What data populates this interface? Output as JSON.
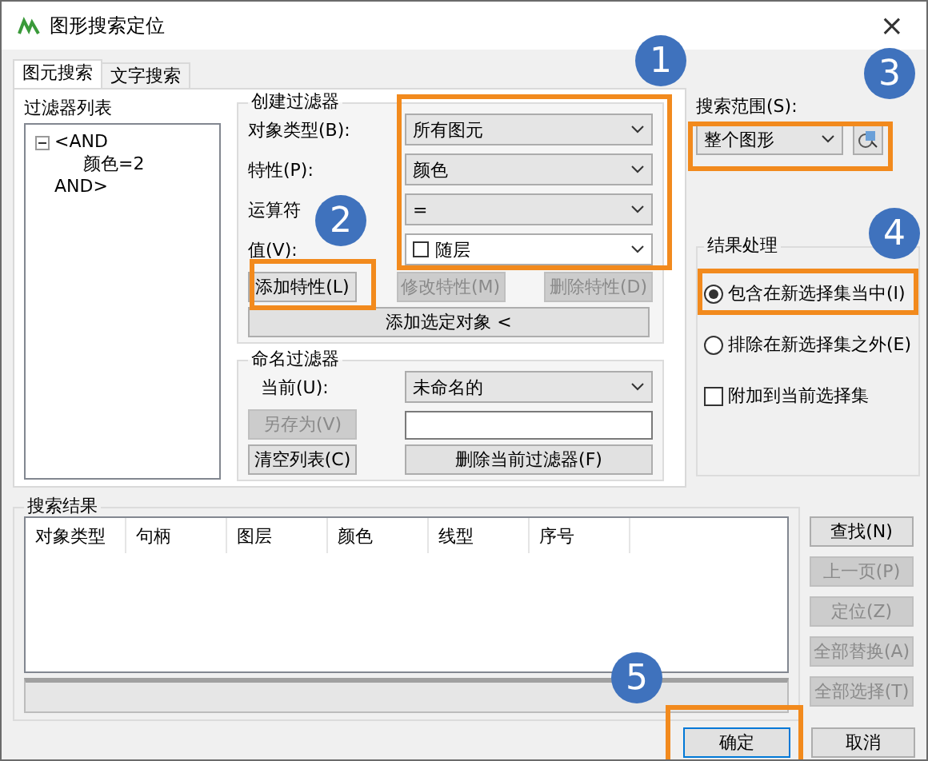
{
  "window": {
    "title": "图形搜索定位",
    "close": "×"
  },
  "tabs": [
    {
      "label": "图元搜索",
      "selected": true
    },
    {
      "label": "文字搜索",
      "selected": false
    }
  ],
  "filter_list": {
    "label": "过滤器列表",
    "tree": [
      {
        "label": "<AND",
        "expanded": true,
        "children": [
          {
            "label": "颜色=2"
          }
        ]
      },
      {
        "label": "AND>"
      }
    ]
  },
  "create_filter": {
    "title": "创建过滤器",
    "fields": [
      {
        "label": "对象类型(B):",
        "value": "所有图元",
        "kind": "select"
      },
      {
        "label": "特性(P):",
        "value": "颜色",
        "kind": "select"
      },
      {
        "label": "运算符",
        "value": "=",
        "kind": "select"
      },
      {
        "label": "值(V):",
        "value": "随层",
        "kind": "swatch"
      }
    ],
    "buttons": [
      {
        "label": "添加特性(L)",
        "disabled": false
      },
      {
        "label": "修改特性(M)",
        "disabled": true
      },
      {
        "label": "删除特性(D)",
        "disabled": true
      }
    ],
    "add_selected": "添加选定对象 <"
  },
  "named_filter": {
    "title": "命名过滤器",
    "current_label": "当前(U):",
    "current_value": "未命名的",
    "save_as": {
      "label": "另存为(V)",
      "disabled": true
    },
    "clear": "清空列表(C)",
    "delete": "删除当前过滤器(F)"
  },
  "search_scope": {
    "label": "搜索范围(S):",
    "value": "整个图形"
  },
  "result_handling": {
    "title": "结果处理",
    "options": [
      {
        "label": "包含在新选择集当中(I)",
        "selected": true
      },
      {
        "label": "排除在新选择集之外(E)",
        "selected": false
      }
    ],
    "append": {
      "label": "附加到当前选择集",
      "checked": false
    }
  },
  "results": {
    "title": "搜索结果",
    "columns": [
      "对象类型",
      "句柄",
      "图层",
      "颜色",
      "线型",
      "序号"
    ],
    "buttons": [
      {
        "label": "查找(N)",
        "disabled": false
      },
      {
        "label": "上一页(P)",
        "disabled": true
      },
      {
        "label": "定位(Z)",
        "disabled": true
      },
      {
        "label": "全部替换(A)",
        "disabled": true
      },
      {
        "label": "全部选择(T)",
        "disabled": true
      }
    ]
  },
  "footer": [
    {
      "label": "确定",
      "default": true
    },
    {
      "label": "取消",
      "default": false
    }
  ],
  "callouts": [
    {
      "label": "1"
    },
    {
      "label": "2"
    },
    {
      "label": "3"
    },
    {
      "label": "4"
    },
    {
      "label": "5"
    }
  ]
}
